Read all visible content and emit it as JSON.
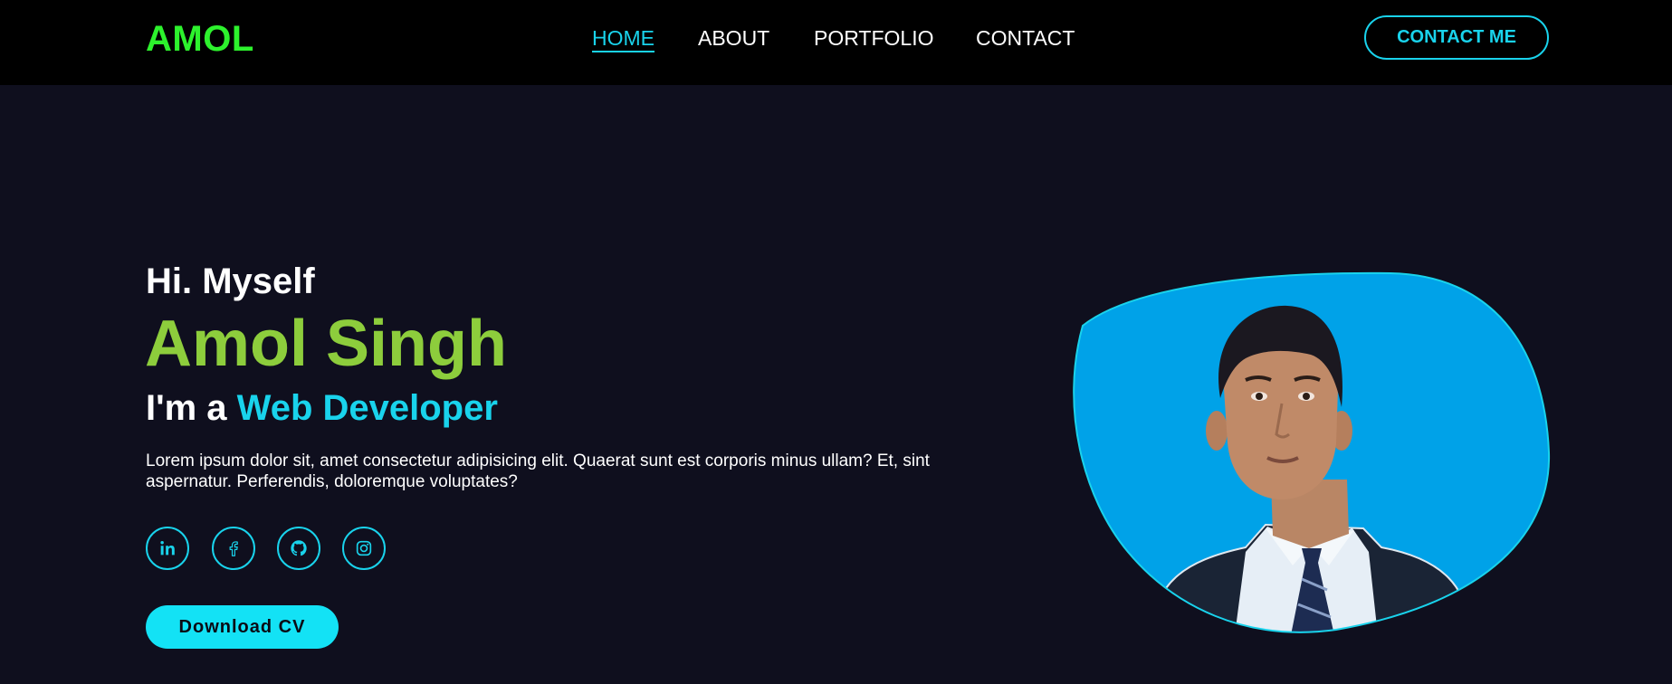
{
  "brand": {
    "logo": "AMOL"
  },
  "nav": {
    "items": [
      {
        "label": "HOME",
        "active": true
      },
      {
        "label": "ABOUT",
        "active": false
      },
      {
        "label": "PORTFOLIO",
        "active": false
      },
      {
        "label": "CONTACT",
        "active": false
      }
    ],
    "cta_label": "CONTACT ME"
  },
  "hero": {
    "greeting": "Hi. Myself",
    "name": "Amol Singh",
    "role_prefix": "I'm a ",
    "role": "Web Developer",
    "description": "Lorem ipsum dolor sit, amet consectetur adipisicing elit. Quaerat sunt est corporis minus ullam? Et, sint aspernatur. Perferendis, doloremque voluptates?",
    "download_label": "Download CV"
  },
  "social": [
    {
      "icon": "linkedin-icon"
    },
    {
      "icon": "facebook-icon"
    },
    {
      "icon": "github-icon"
    },
    {
      "icon": "instagram-icon"
    }
  ],
  "colors": {
    "background": "#0f0f1e",
    "navbar": "#000000",
    "logo": "#2df22d",
    "accent": "#19d3ec",
    "name": "#8dcd3c",
    "blob": "#00a2e8"
  }
}
